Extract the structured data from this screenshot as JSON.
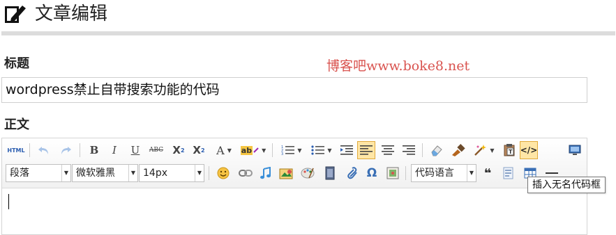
{
  "header": {
    "title": "文章编辑",
    "icon": "edit-icon"
  },
  "watermark": "博客吧www.boke8.net",
  "title_field": {
    "label": "标题",
    "value": "wordpress禁止自带搜索功能的代码"
  },
  "body_field": {
    "label": "正文"
  },
  "toolbar": {
    "html_label": "HTML",
    "bold": "B",
    "italic": "I",
    "underline": "U",
    "strike": "ABC",
    "superscript_base": "X",
    "superscript_mark": "2",
    "subscript_base": "X",
    "subscript_mark": "2",
    "font_color": "A",
    "highlight": "ab",
    "paragraph_select": "段落",
    "font_family_select": "微软雅黑",
    "font_size_select": "14px",
    "code_language_select": "代码语言",
    "quote_mark": "❝"
  },
  "tooltip": "插入无名代码框",
  "colors": {
    "watermark": "#d9534f",
    "active_bg": "#ffe6a6",
    "toolbar_bg": "#f1f1f1"
  }
}
